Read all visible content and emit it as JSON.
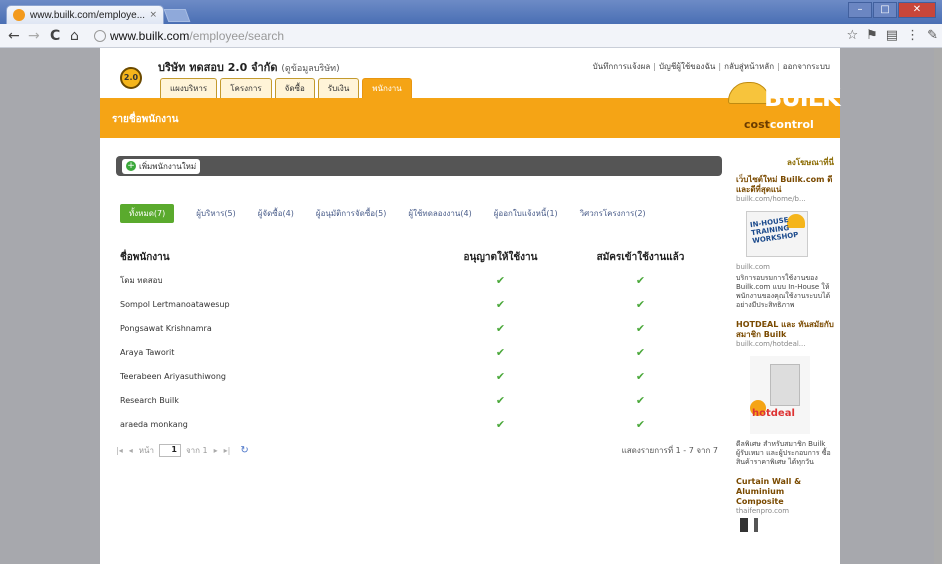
{
  "browser": {
    "tab_title": "www.builk.com/employe...",
    "tab_close": "×",
    "url_host": "www.builk.com",
    "url_path": "/employee/search",
    "nav": {
      "back": "←",
      "forward": "→",
      "reload": "C",
      "home": "⌂"
    },
    "toolbar_icons": [
      "☆",
      "⚑",
      "▤",
      "⋮",
      "✎"
    ],
    "window_buttons": {
      "minimize": "–",
      "maximize": "□",
      "close": "✕"
    }
  },
  "site": {
    "logo_text": "2.0",
    "company_name": "บริษัท ทดสอบ 2.0 จำกัด",
    "company_sub": "(ดูข้อมูลบริษัท)",
    "top_links": [
      "บันทึกการแจ้งผล",
      "บัญชีผู้ใช้ของฉัน",
      "กลับสู่หน้าหลัก",
      "ออกจากระบบ"
    ],
    "main_tabs": [
      {
        "label": "แผงบริหาร",
        "active": false
      },
      {
        "label": "โครงการ",
        "active": false
      },
      {
        "label": "จัดซื้อ",
        "active": false
      },
      {
        "label": "รับเงิน",
        "active": false
      },
      {
        "label": "พนักงาน",
        "active": true
      }
    ],
    "section_title": "รายชื่อพนักงาน",
    "brand": {
      "name": "BUILK",
      "cost": "cost",
      "control": "control"
    }
  },
  "content": {
    "add_button": "เพิ่มพนักงานใหม่",
    "filters": [
      {
        "label": "ทั้งหมด(7)",
        "active": true
      },
      {
        "label": "ผู้บริหาร(5)",
        "active": false
      },
      {
        "label": "ผู้จัดซื้อ(4)",
        "active": false
      },
      {
        "label": "ผู้อนุมัติการจัดซื้อ(5)",
        "active": false
      },
      {
        "label": "ผู้ใช้ทดลองงาน(4)",
        "active": false
      },
      {
        "label": "ผู้ออกใบแจ้งหนี้(1)",
        "active": false
      },
      {
        "label": "วิศวกรโครงการ(2)",
        "active": false
      }
    ],
    "table": {
      "headers": [
        "ชื่อพนักงาน",
        "อนุญาตให้ใช้งาน",
        "สมัครเข้าใช้งานแล้ว"
      ],
      "check": "✔",
      "rows": [
        {
          "name": "โดม ทดสอบ",
          "allowed": true,
          "registered": true
        },
        {
          "name": "Sompol Lertmanoatawesup",
          "allowed": true,
          "registered": true
        },
        {
          "name": "Pongsawat Krishnamra",
          "allowed": true,
          "registered": true
        },
        {
          "name": "Araya Taworit",
          "allowed": true,
          "registered": true
        },
        {
          "name": "Teerabeen Ariyasuthiwong",
          "allowed": true,
          "registered": true
        },
        {
          "name": "Research Builk",
          "allowed": true,
          "registered": true
        },
        {
          "name": "araeda monkang",
          "allowed": true,
          "registered": true
        }
      ]
    },
    "pager": {
      "first": "|◂",
      "prev": "◂",
      "page_label": "หน้า",
      "page_value": "1",
      "of_label": "จาก 1",
      "next": "▸",
      "last": "▸|",
      "refresh": "↻",
      "display_text": "แสดงรายการที่ 1 - 7 จาก 7"
    }
  },
  "sidebar": {
    "heading": "ลงโฆษณาที่นี่",
    "ads": [
      {
        "title": "เว็บไซต์ใหม่ Builk.com ดี และดีที่สุดแน่",
        "url": "builk.com/home/b...",
        "text": ""
      },
      {
        "title": "",
        "url": "builk.com",
        "text": "บริการอบรมการใช้งานของ Builk.com แบบ In-House ให้พนักงานของคุณใช้งานระบบได้อย่างมีประสิทธิภาพ"
      },
      {
        "title": "HOTDEAL และ ทันสมัยกับ สมาชิก Builk",
        "url": "builk.com/hotdeal...",
        "text": ""
      },
      {
        "title": "",
        "url": "",
        "text": "ดีลพิเศษ สำหรับสมาชิก Builk ผู้รับเหมา และผู้ประกอบการ ซื้อสินค้าราคาพิเศษ ได้ทุกวัน"
      },
      {
        "title": "Curtain Wall & Aluminium Composite",
        "url": "thaifenpro.com",
        "text": ""
      }
    ],
    "training": {
      "line1": "IN-HOUSE",
      "line2": "TRAINING",
      "line3": "WORKSHOP"
    },
    "hotdeal_label": "hotdeal"
  }
}
